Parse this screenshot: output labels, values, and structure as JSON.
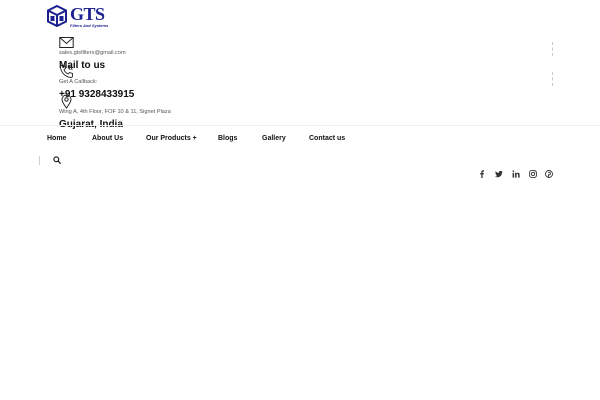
{
  "brand": {
    "name": "GTS",
    "tagline": "Filters And Systems",
    "color": "#1b1f8f"
  },
  "contacts": [
    {
      "icon": "mail-icon",
      "small": "sales.gtsfilters@gmail.com",
      "big": "Mail to us"
    },
    {
      "icon": "phone-icon",
      "small": "Get A Callback:",
      "big": "+91 9328433915"
    },
    {
      "icon": "location-pin-icon",
      "small": "Wing A, 4th Floor, FOF 10 & 11, Signet Plaza",
      "big": "Gujarat, India"
    }
  ],
  "nav": {
    "items": [
      "Home",
      "About Us",
      "Our Products +",
      "Blogs",
      "Gallery",
      "Contact us"
    ]
  },
  "search": {
    "icon": "search-icon"
  },
  "social": [
    "facebook-icon",
    "twitter-icon",
    "linkedin-icon",
    "instagram-icon",
    "pinterest-icon"
  ]
}
